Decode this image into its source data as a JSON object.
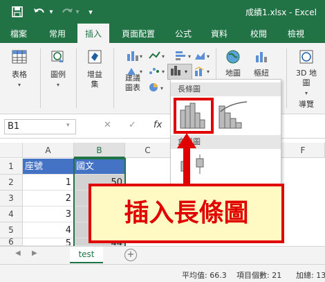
{
  "window": {
    "filename": "成績1.xlsx - Excel"
  },
  "quick_access": {
    "undo_caret": "▾",
    "redo_caret": "▾",
    "more": "▾"
  },
  "tabs": [
    {
      "label": "檔案"
    },
    {
      "label": "常用"
    },
    {
      "label": "插入",
      "active": true
    },
    {
      "label": "頁面配置"
    },
    {
      "label": "公式"
    },
    {
      "label": "資料"
    },
    {
      "label": "校閱"
    },
    {
      "label": "檢視"
    }
  ],
  "ribbon": {
    "table": "表格",
    "illustrations": "圖例",
    "addins_1": "增益",
    "addins_2": "集",
    "recommended_1": "建議",
    "recommended_2": "圖表",
    "map_cut": "地圖",
    "pivot_cut": "樞紐",
    "map3d_1": "3D 地",
    "map3d_2": "圖",
    "tour": "導覽"
  },
  "formula_bar": {
    "name_box": "B1",
    "cancel": "✕",
    "enter": "✓",
    "fx": "fx"
  },
  "grid": {
    "columns": [
      "A",
      "B",
      "C",
      "F"
    ],
    "rows": [
      "1",
      "2",
      "3",
      "4",
      "5",
      "6"
    ],
    "a_header": "座號",
    "b_header": "國文",
    "a_values": [
      "1",
      "2",
      "3",
      "4",
      "5"
    ],
    "b_values": [
      "50",
      "",
      "",
      "",
      "44"
    ]
  },
  "dropdown": {
    "histogram_header": "長條圖",
    "boxplot_header": "盒鬚圖"
  },
  "callout": {
    "text": "插入長條圖"
  },
  "sheets": {
    "active": "test",
    "add": "+"
  },
  "status": {
    "average": "平均值: 66.3",
    "count": "項目個數: 21",
    "sum": "加總: 1393"
  },
  "colors": {
    "accent": "#217346",
    "table_header": "#4472c4",
    "highlight": "#e00000"
  }
}
